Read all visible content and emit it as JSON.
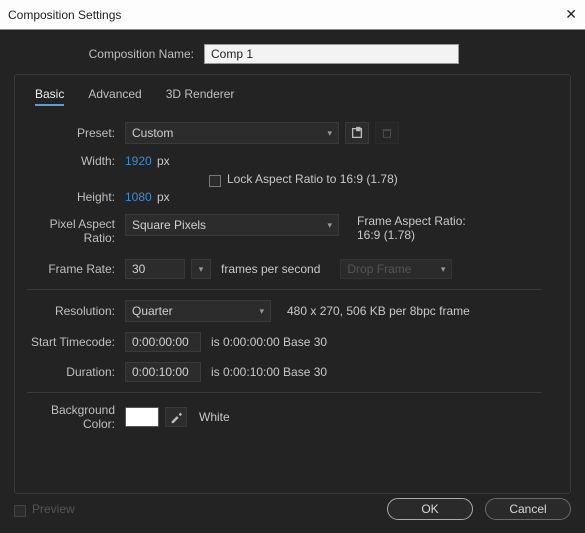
{
  "title": "Composition Settings",
  "comp_name_label": "Composition Name:",
  "comp_name_value": "Comp 1",
  "tabs": {
    "basic": "Basic",
    "advanced": "Advanced",
    "renderer": "3D Renderer"
  },
  "preset": {
    "label": "Preset:",
    "value": "Custom"
  },
  "width": {
    "label": "Width:",
    "value": "1920",
    "unit": "px"
  },
  "height": {
    "label": "Height:",
    "value": "1080",
    "unit": "px"
  },
  "lock_aspect": "Lock Aspect Ratio to 16:9 (1.78)",
  "par": {
    "label": "Pixel Aspect Ratio:",
    "value": "Square Pixels"
  },
  "frame_aspect": {
    "label": "Frame Aspect Ratio:",
    "value": "16:9 (1.78)"
  },
  "frame_rate": {
    "label": "Frame Rate:",
    "value": "30",
    "unit": "frames per second",
    "drop": "Drop Frame"
  },
  "resolution": {
    "label": "Resolution:",
    "value": "Quarter",
    "info": "480 x 270, 506 KB per 8bpc frame"
  },
  "start_tc": {
    "label": "Start Timecode:",
    "value": "0:00:00:00",
    "info": "is 0:00:00:00 Base 30"
  },
  "duration": {
    "label": "Duration:",
    "value": "0:00:10:00",
    "info": "is 0:00:10:00 Base 30"
  },
  "bg": {
    "label": "Background Color:",
    "name": "White",
    "hex": "#ffffff"
  },
  "footer": {
    "preview": "Preview",
    "ok": "OK",
    "cancel": "Cancel"
  }
}
